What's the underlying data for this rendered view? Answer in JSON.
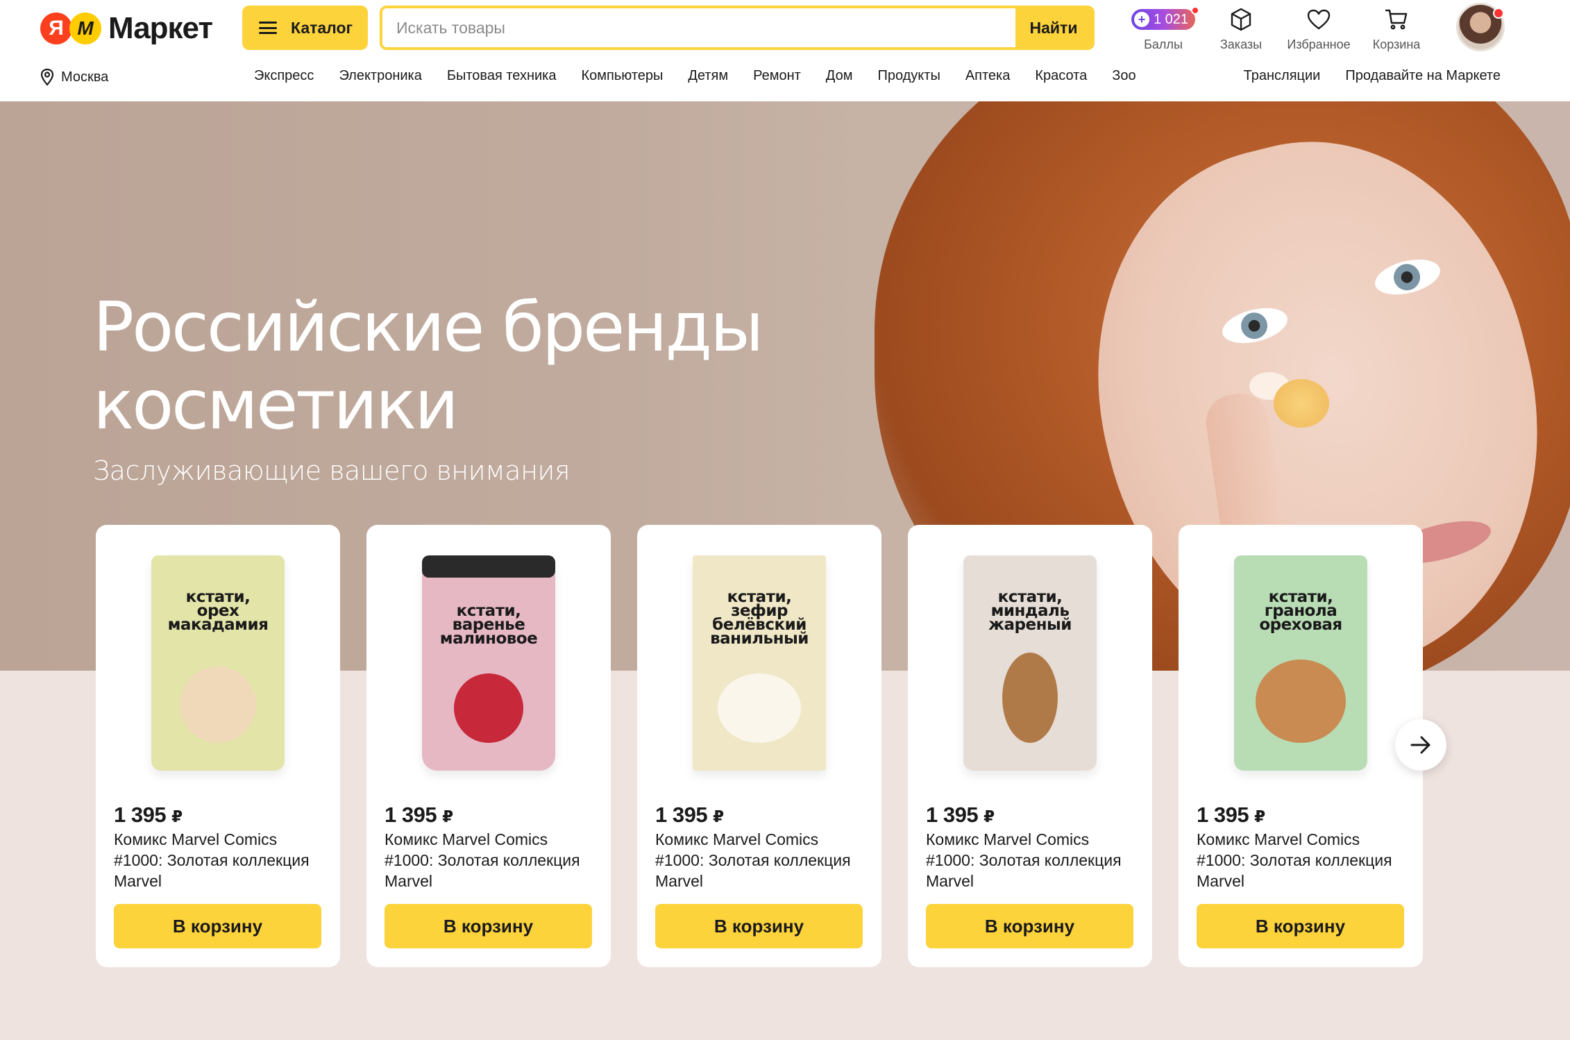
{
  "brand": {
    "logo_ya": "Я",
    "logo_m": "М",
    "logo_text": "Маркет"
  },
  "header": {
    "catalog_label": "Каталог",
    "search_placeholder": "Искать товары",
    "search_button": "Найти",
    "actions": [
      {
        "label": "Баллы",
        "value": "1 021",
        "icon": "points-icon"
      },
      {
        "label": "Заказы",
        "icon": "box-icon"
      },
      {
        "label": "Избранное",
        "icon": "heart-icon"
      },
      {
        "label": "Корзина",
        "icon": "cart-icon"
      }
    ]
  },
  "location": {
    "city": "Москва"
  },
  "nav": {
    "items": [
      "Экспресс",
      "Электроника",
      "Бытовая техника",
      "Компьютеры",
      "Детям",
      "Ремонт",
      "Дом",
      "Продукты",
      "Аптека",
      "Красота",
      "Зоо"
    ],
    "right": [
      "Трансляции",
      "Продавайте на Маркете"
    ]
  },
  "hero": {
    "title": "Российские бренды косметики",
    "subtitle": "Заслуживающие вашего внимания"
  },
  "products": [
    {
      "pkg_text": "кстати,\nорех\nмакадамия",
      "pkg_color": "#e3e4a8",
      "blob_color": "#efd9b8",
      "blob_w": 110,
      "blob_h": 110,
      "price": "1 395",
      "currency": "₽",
      "name": "Комикс Marvel Comics #1000: Золотая коллекция Marvel",
      "cart": "В корзину",
      "kind": "pouch"
    },
    {
      "pkg_text": "кстати,\nваренье\nмалиновое",
      "pkg_color": "#e6b8c4",
      "blob_color": "#c7283a",
      "blob_w": 100,
      "blob_h": 100,
      "price": "1 395",
      "currency": "₽",
      "name": "Комикс Marvel Comics #1000: Золотая коллекция Marvel",
      "cart": "В корзину",
      "kind": "jar"
    },
    {
      "pkg_text": "кстати,\nзефир\nбелёвский\nванильный",
      "pkg_color": "#f0e7c6",
      "blob_color": "#fbf6ec",
      "blob_w": 120,
      "blob_h": 100,
      "price": "1 395",
      "currency": "₽",
      "name": "Комикс Marvel Comics #1000: Золотая коллекция Marvel",
      "cart": "В корзину",
      "kind": "box"
    },
    {
      "pkg_text": "кстати,\nминдаль\nжареный",
      "pkg_color": "#e6ddd6",
      "blob_color": "#b07a48",
      "blob_w": 80,
      "blob_h": 130,
      "price": "1 395",
      "currency": "₽",
      "name": "Комикс Marvel Comics #1000: Золотая коллекция Marvel",
      "cart": "В корзину",
      "kind": "pouch"
    },
    {
      "pkg_text": "кстати,\nгранола\nореховая",
      "pkg_color": "#b8dcb4",
      "blob_color": "#c98b52",
      "blob_w": 130,
      "blob_h": 120,
      "price": "1 395",
      "currency": "₽",
      "name": "Комикс Marvel Comics #1000: Золотая коллекция Marvel",
      "cart": "В корзину",
      "kind": "pouch"
    }
  ],
  "colors": {
    "accent": "#fdd33c",
    "brand_red": "#fc3f1d",
    "hero_bg": "#bba496",
    "lower_bg": "#efe3df"
  }
}
